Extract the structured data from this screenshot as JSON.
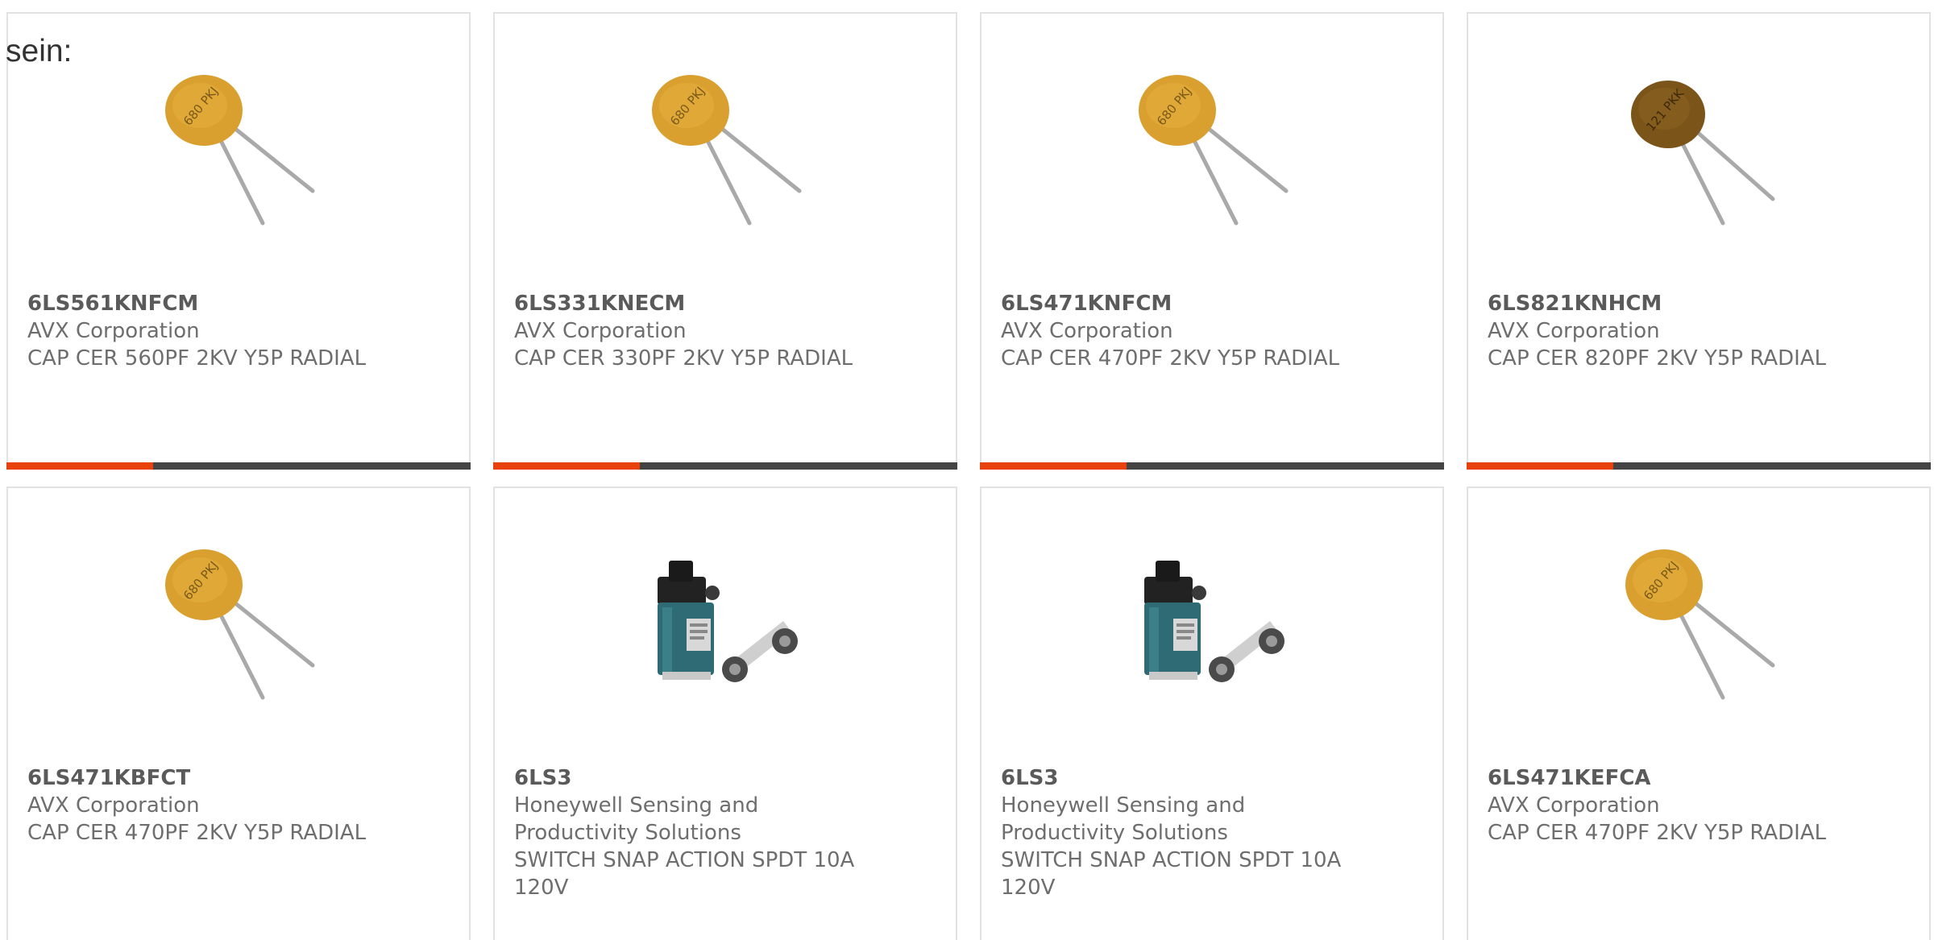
{
  "page_label": "sein:",
  "colors": {
    "accent": "#e8410c",
    "bar_base": "#444444",
    "card_border": "#e2e2e2",
    "text": "#6e6e6e"
  },
  "products": [
    {
      "part_number": "6LS561KNFCM",
      "manufacturer": "AVX Corporation",
      "description": "CAP CER 560PF 2KV Y5P RADIAL",
      "image_icon": "ceramic-capacitor-icon",
      "image_text": "680 PKJ",
      "accent_bar": true
    },
    {
      "part_number": "6LS331KNECM",
      "manufacturer": "AVX Corporation",
      "description": "CAP CER 330PF 2KV Y5P RADIAL",
      "image_icon": "ceramic-capacitor-icon",
      "image_text": "680 PKJ",
      "accent_bar": true
    },
    {
      "part_number": "6LS471KNFCM",
      "manufacturer": "AVX Corporation",
      "description": "CAP CER 470PF 2KV Y5P RADIAL",
      "image_icon": "ceramic-capacitor-icon",
      "image_text": "680 PKJ",
      "accent_bar": true
    },
    {
      "part_number": "6LS821KNHCM",
      "manufacturer": "AVX Corporation",
      "description": "CAP CER 820PF 2KV Y5P RADIAL",
      "image_icon": "ceramic-capacitor-icon",
      "image_text": "121 PKK",
      "accent_bar": true
    },
    {
      "part_number": "6LS471KBFCT",
      "manufacturer": "AVX Corporation",
      "description": "CAP CER 470PF 2KV Y5P RADIAL",
      "image_icon": "ceramic-capacitor-icon",
      "image_text": "680 PKJ",
      "accent_bar": false
    },
    {
      "part_number": "6LS3",
      "manufacturer": "Honeywell Sensing and Productivity Solutions",
      "description": "SWITCH SNAP ACTION SPDT 10A 120V",
      "image_icon": "limit-switch-icon",
      "accent_bar": false
    },
    {
      "part_number": "6LS3",
      "manufacturer": "Honeywell Sensing and Productivity Solutions",
      "description": "SWITCH SNAP ACTION SPDT 10A 120V",
      "image_icon": "limit-switch-icon",
      "accent_bar": false
    },
    {
      "part_number": "6LS471KEFCA",
      "manufacturer": "AVX Corporation",
      "description": "CAP CER 470PF 2KV Y5P RADIAL",
      "image_icon": "ceramic-capacitor-icon",
      "image_text": "680 PKJ",
      "accent_bar": false
    }
  ]
}
